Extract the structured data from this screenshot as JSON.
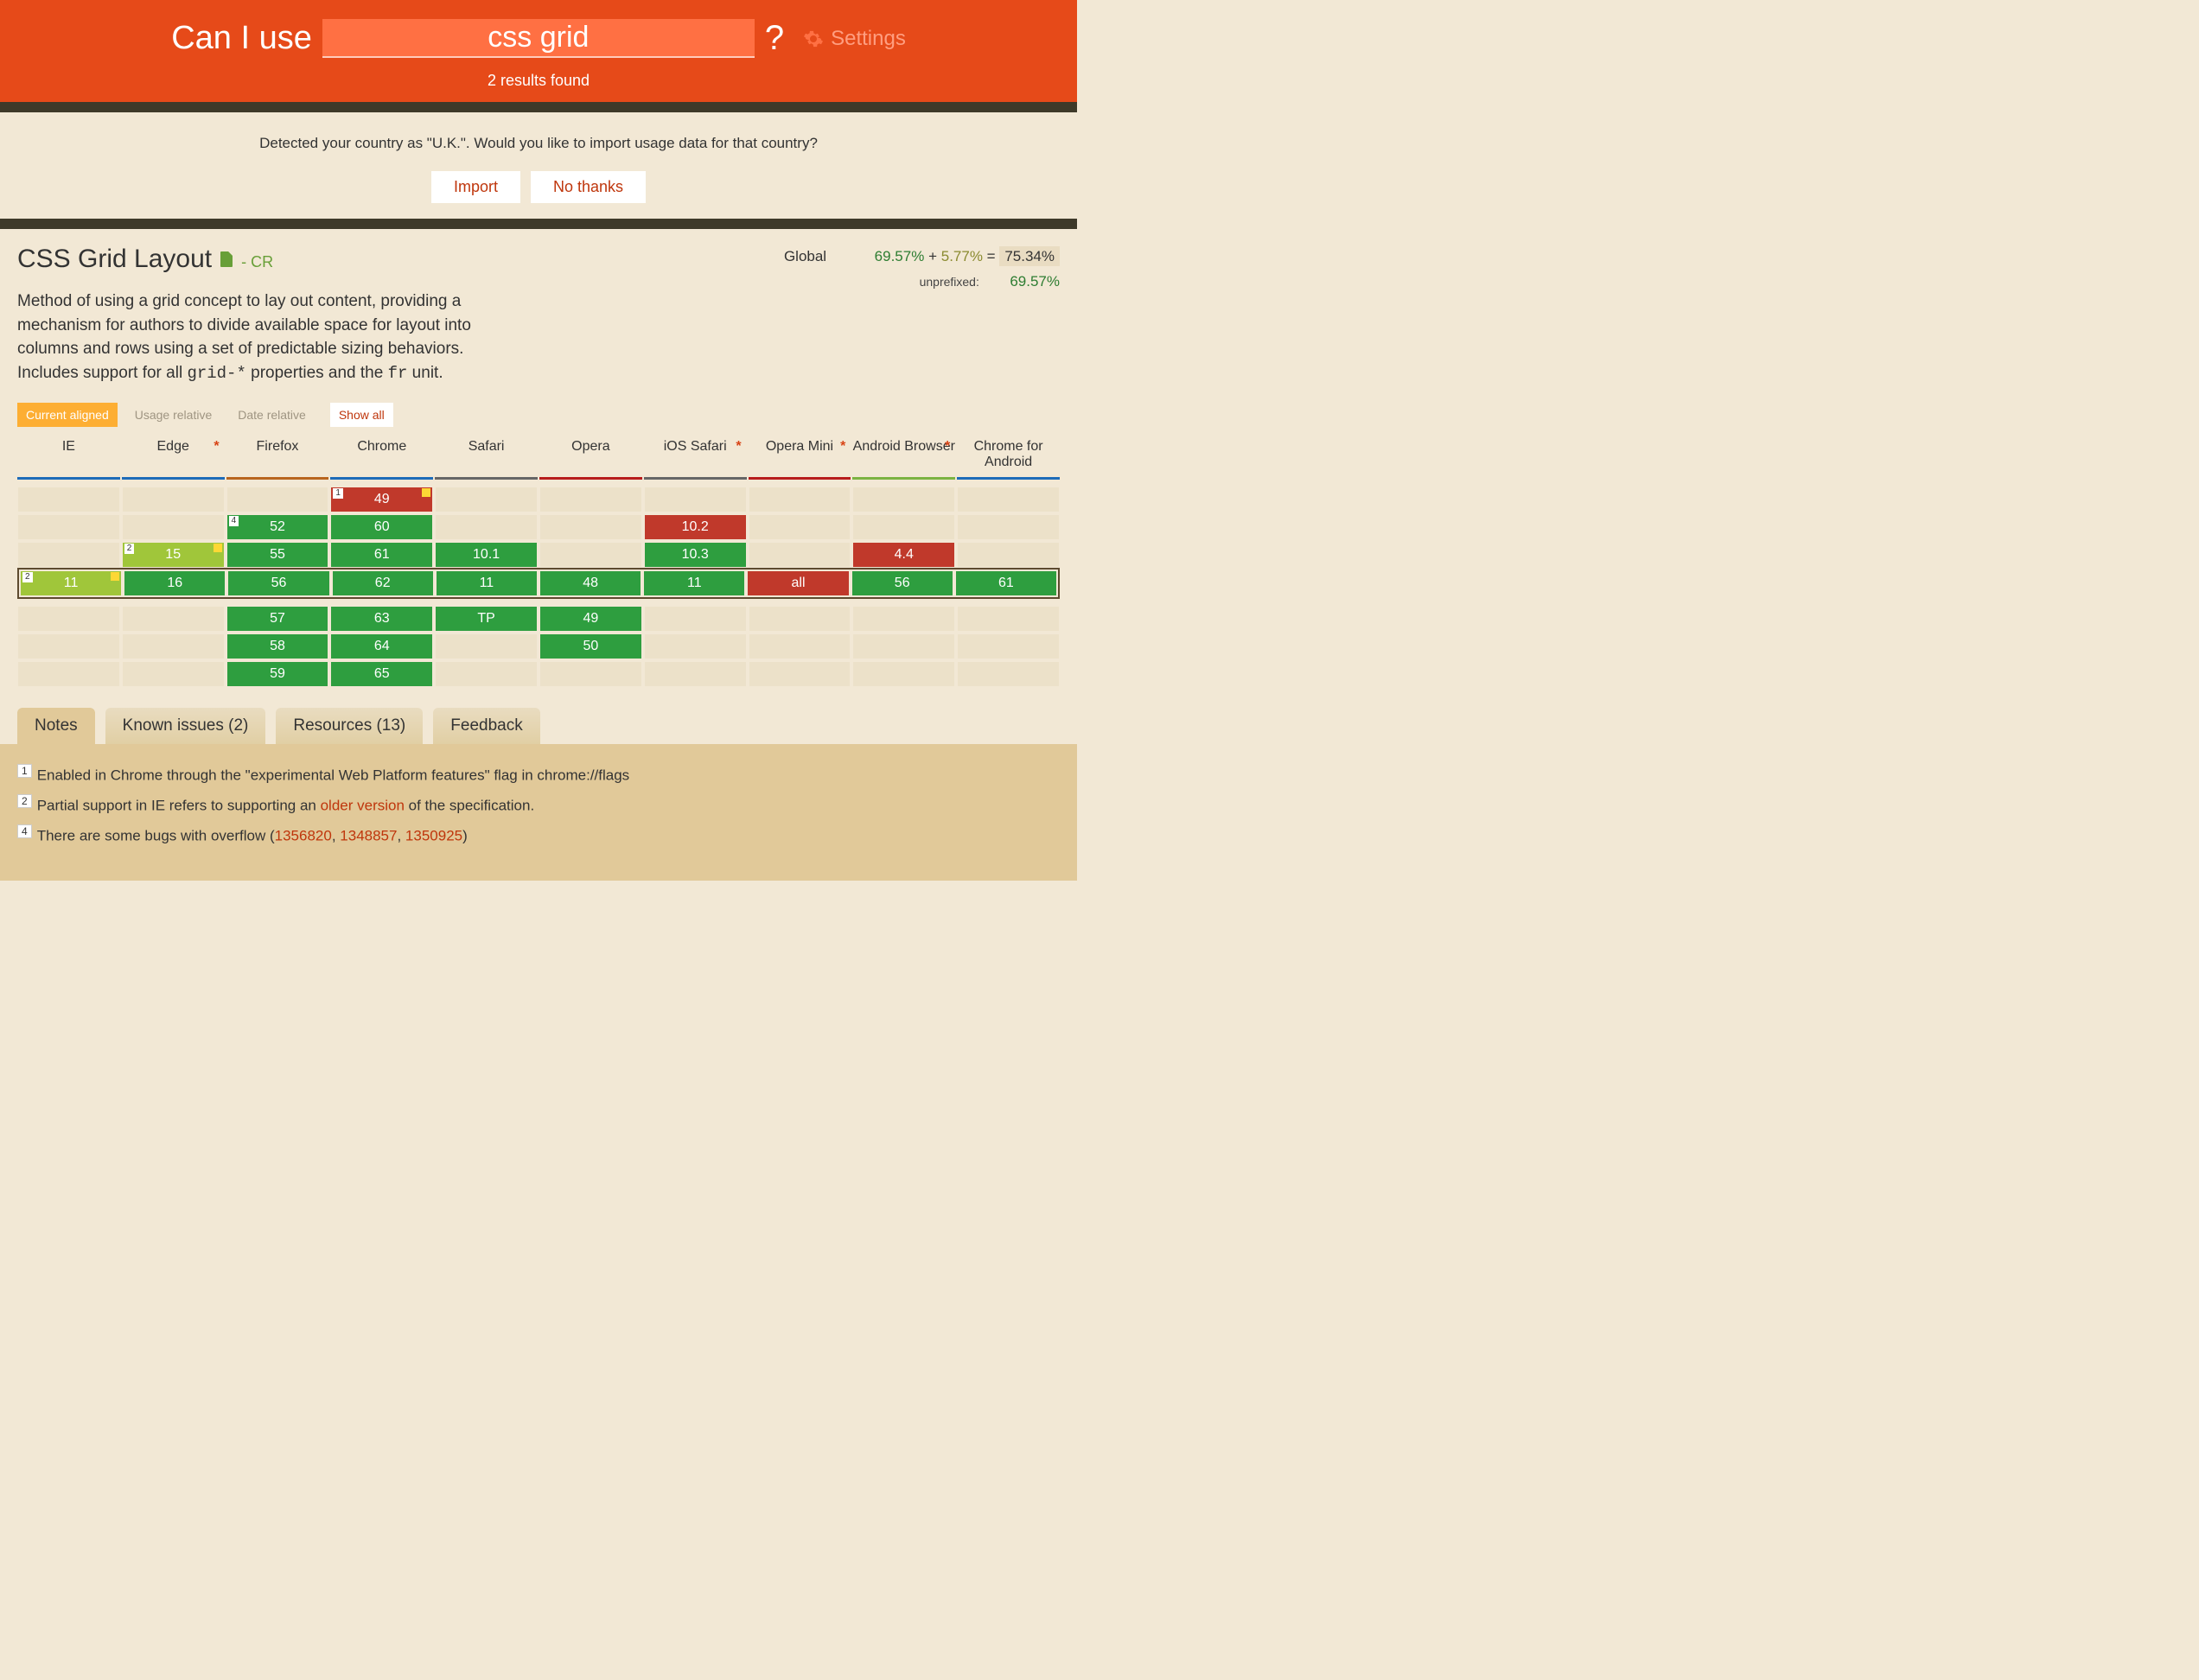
{
  "header": {
    "brand": "Can I use",
    "search_value": "css grid",
    "qmark": "?",
    "settings": "Settings",
    "results": "2 results found"
  },
  "country": {
    "prompt": "Detected your country as \"U.K.\". Would you like to import usage data for that country?",
    "import": "Import",
    "nothanks": "No thanks"
  },
  "feature": {
    "title": "CSS Grid Layout",
    "cr": "- CR",
    "desc_pre": "Method of using a grid concept to lay out content, providing a mechanism for authors to divide available space for layout into columns and rows using a set of predictable sizing behaviors. Includes support for all ",
    "code1": "grid-*",
    "desc_mid": " properties and the ",
    "code2": "fr",
    "desc_post": " unit."
  },
  "global": {
    "label": "Global",
    "pct_green": "69.57%",
    "plus": " + ",
    "pct_olive": "5.77%",
    "eq": " = ",
    "pct_total": "75.34%",
    "unprefixed_label": "unprefixed:",
    "unprefixed_val": "69.57%"
  },
  "views": {
    "current": "Current aligned",
    "usage": "Usage relative",
    "date": "Date relative",
    "showall": "Show all"
  },
  "browsers": [
    {
      "name": "IE",
      "color": "#1e6bb8",
      "ast": false
    },
    {
      "name": "Edge",
      "color": "#1e6bb8",
      "ast": true
    },
    {
      "name": "Firefox",
      "color": "#b8651e",
      "ast": false
    },
    {
      "name": "Chrome",
      "color": "#1e6bb8",
      "ast": false
    },
    {
      "name": "Safari",
      "color": "#666",
      "ast": false
    },
    {
      "name": "Opera",
      "color": "#b71c1c",
      "ast": false
    },
    {
      "name": "iOS Safari",
      "color": "#666",
      "ast": true
    },
    {
      "name": "Opera Mini",
      "color": "#b71c1c",
      "ast": true
    },
    {
      "name": "Android Browser",
      "color": "#7cb342",
      "ast": true
    },
    {
      "name": "Chrome for Android",
      "color": "#1e6bb8",
      "ast": false
    }
  ],
  "rows_past": [
    [
      null,
      null,
      null,
      {
        "v": "49",
        "c": "red",
        "n": "1",
        "f": true
      },
      null,
      null,
      null,
      null,
      null,
      null
    ],
    [
      null,
      null,
      {
        "v": "52",
        "c": "green",
        "n": "4"
      },
      {
        "v": "60",
        "c": "green"
      },
      null,
      null,
      {
        "v": "10.2",
        "c": "red"
      },
      null,
      null,
      null
    ],
    [
      null,
      {
        "v": "15",
        "c": "olive",
        "n": "2",
        "f": true
      },
      {
        "v": "55",
        "c": "green"
      },
      {
        "v": "61",
        "c": "green"
      },
      {
        "v": "10.1",
        "c": "green"
      },
      null,
      {
        "v": "10.3",
        "c": "green"
      },
      null,
      {
        "v": "4.4",
        "c": "red"
      },
      null
    ]
  ],
  "row_current": [
    {
      "v": "11",
      "c": "olive",
      "n": "2",
      "f": true
    },
    {
      "v": "16",
      "c": "green"
    },
    {
      "v": "56",
      "c": "green"
    },
    {
      "v": "62",
      "c": "green"
    },
    {
      "v": "11",
      "c": "green"
    },
    {
      "v": "48",
      "c": "green"
    },
    {
      "v": "11",
      "c": "green"
    },
    {
      "v": "all",
      "c": "red"
    },
    {
      "v": "56",
      "c": "green"
    },
    {
      "v": "61",
      "c": "green"
    }
  ],
  "rows_future": [
    [
      null,
      null,
      {
        "v": "57",
        "c": "green"
      },
      {
        "v": "63",
        "c": "green"
      },
      {
        "v": "TP",
        "c": "green"
      },
      {
        "v": "49",
        "c": "green"
      },
      null,
      null,
      null,
      null
    ],
    [
      null,
      null,
      {
        "v": "58",
        "c": "green"
      },
      {
        "v": "64",
        "c": "green"
      },
      null,
      {
        "v": "50",
        "c": "green"
      },
      null,
      null,
      null,
      null
    ],
    [
      null,
      null,
      {
        "v": "59",
        "c": "green"
      },
      {
        "v": "65",
        "c": "green"
      },
      null,
      null,
      null,
      null,
      null,
      null
    ]
  ],
  "tabs": {
    "notes": "Notes",
    "known": "Known issues (2)",
    "resources": "Resources (13)",
    "feedback": "Feedback"
  },
  "notes": {
    "n1": "Enabled in Chrome through the \"experimental Web Platform features\" flag in chrome://flags",
    "n2_pre": "Partial support in IE refers to supporting an ",
    "n2_link": "older version",
    "n2_post": " of the specification.",
    "n4_pre": "There are some bugs with overflow (",
    "n4_l1": "1356820",
    "n4_c1": ", ",
    "n4_l2": "1348857",
    "n4_c2": ", ",
    "n4_l3": "1350925",
    "n4_post": ")"
  }
}
